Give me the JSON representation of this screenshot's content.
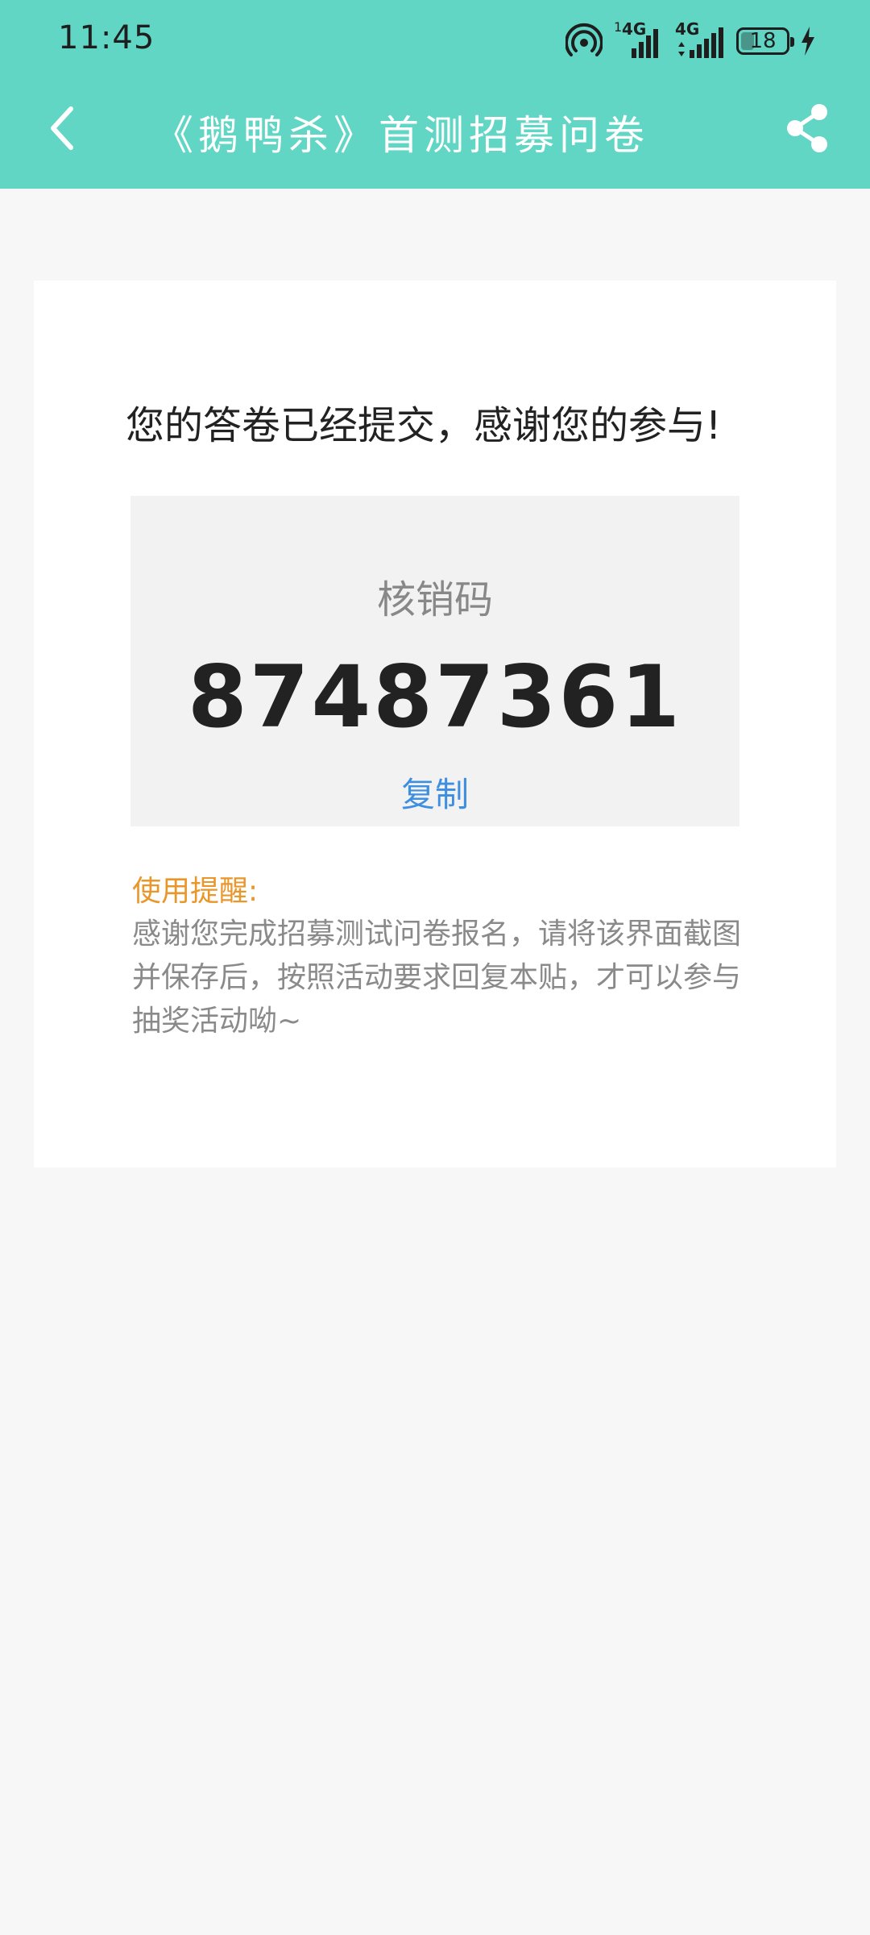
{
  "status_bar": {
    "time": "11:45",
    "battery_level": "18",
    "sim1_network": "4G",
    "sim2_network": "4G",
    "sim1_slot": "1"
  },
  "nav": {
    "title": "《鹅鸭杀》首测招募问卷"
  },
  "result": {
    "message": "您的答卷已经提交，感谢您的参与!",
    "code_label": "核销码",
    "code_value": "87487361",
    "copy_label": "复制"
  },
  "reminder": {
    "title": "使用提醒:",
    "body": "感谢您完成招募测试问卷报名，请将该界面截图并保存后，按照活动要求回复本贴，才可以参与抽奖活动呦~"
  },
  "colors": {
    "header_bg": "#62d6c5",
    "page_bg": "#f7f7f7",
    "link_blue": "#3f8fe0",
    "reminder_orange": "#e9962a"
  },
  "icons": {
    "back": "back-arrow-icon",
    "share": "share-icon",
    "hotspot": "hotspot-icon",
    "signal": "signal-icon",
    "battery": "battery-icon",
    "charging": "charging-bolt-icon"
  }
}
